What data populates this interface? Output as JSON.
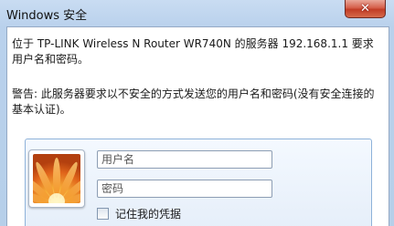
{
  "window": {
    "title": "Windows 安全",
    "close_glyph": "✕"
  },
  "message": {
    "line1": "位于 TP-LINK Wireless N Router WR740N 的服务器 192.168.1.1 要求用户名和密码。",
    "warning": "警告: 此服务器要求以不安全的方式发送您的用户名和密码(没有安全连接的基本认证)。"
  },
  "credentials": {
    "user_tile_icon": "flower-user-picture",
    "username_placeholder": "用户名",
    "password_placeholder": "密码",
    "remember_label": "记住我的凭据",
    "remember_checked": false
  }
}
